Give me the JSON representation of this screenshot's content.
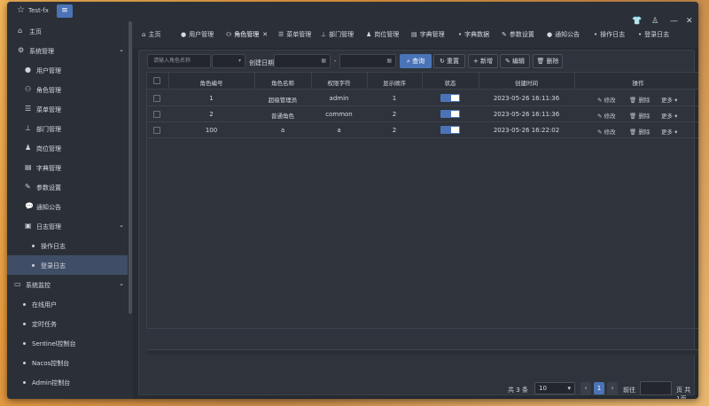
{
  "app": {
    "title": "Test-fx"
  },
  "sidebar": {
    "items": [
      {
        "label": "主页",
        "icon": "home-icon"
      },
      {
        "label": "系统管理",
        "icon": "gear-icon"
      },
      {
        "label": "用户管理",
        "icon": "user-icon"
      },
      {
        "label": "角色管理",
        "icon": "users-icon"
      },
      {
        "label": "菜单管理",
        "icon": "menu-list-icon"
      },
      {
        "label": "部门管理",
        "icon": "org-tree-icon"
      },
      {
        "label": "岗位管理",
        "icon": "post-icon"
      },
      {
        "label": "字典管理",
        "icon": "dictionary-icon"
      },
      {
        "label": "参数设置",
        "icon": "edit-icon"
      },
      {
        "label": "通知公告",
        "icon": "chat-icon"
      },
      {
        "label": "日志管理",
        "icon": "log-icon"
      },
      {
        "label": "操作日志",
        "icon": "dot-icon"
      },
      {
        "label": "登录日志",
        "icon": "dot-icon"
      },
      {
        "label": "系统监控",
        "icon": "monitor-icon"
      },
      {
        "label": "在线用户",
        "icon": "dot-icon"
      },
      {
        "label": "定时任务",
        "icon": "dot-icon"
      },
      {
        "label": "Sentinel控制台",
        "icon": "dot-icon"
      },
      {
        "label": "Nacos控制台",
        "icon": "dot-icon"
      },
      {
        "label": "Admin控制台",
        "icon": "dot-icon"
      }
    ]
  },
  "tabs": [
    {
      "label": "主页",
      "icon": "home-icon"
    },
    {
      "label": "用户管理",
      "icon": "user-icon"
    },
    {
      "label": "角色管理",
      "icon": "users-icon"
    },
    {
      "label": "菜单管理",
      "icon": "menu-list-icon"
    },
    {
      "label": "部门管理",
      "icon": "org-tree-icon"
    },
    {
      "label": "岗位管理",
      "icon": "post-icon"
    },
    {
      "label": "字典管理",
      "icon": "dictionary-icon"
    },
    {
      "label": "字典数据",
      "icon": "dot-icon"
    },
    {
      "label": "参数设置",
      "icon": "edit-icon"
    },
    {
      "label": "通知公告",
      "icon": "chat-icon"
    },
    {
      "label": "操作日志",
      "icon": "dot-icon"
    },
    {
      "label": "登录日志",
      "icon": "dot-icon"
    }
  ],
  "toolbar": {
    "search_placeholder": "请输入角色名称",
    "date_label": "创建日期",
    "date_sep": "-",
    "query": "查询",
    "reset": "重置",
    "add": "新增",
    "edit": "编辑",
    "delete": "删除"
  },
  "table": {
    "headers": [
      "角色编号",
      "角色名称",
      "权限字符",
      "显示顺序",
      "状态",
      "创建时间",
      "操作"
    ],
    "rows": [
      {
        "id": "1",
        "name": "超级管理员",
        "key": "admin",
        "order": "1",
        "status": true,
        "created": "2023-05-26 16:11:36"
      },
      {
        "id": "2",
        "name": "普通角色",
        "key": "common",
        "order": "2",
        "status": true,
        "created": "2023-05-26 16:11:36"
      },
      {
        "id": "100",
        "name": "a",
        "key": "a",
        "order": "2",
        "status": true,
        "created": "2023-05-26 16:22:02"
      }
    ],
    "ops": {
      "edit": "修改",
      "delete": "删除",
      "more": "更多"
    }
  },
  "pager": {
    "total_prefix": "共",
    "total": "3",
    "total_suffix": "条",
    "page_size": "10",
    "current": "1",
    "goto": "前往",
    "pages": "页 共1页"
  }
}
